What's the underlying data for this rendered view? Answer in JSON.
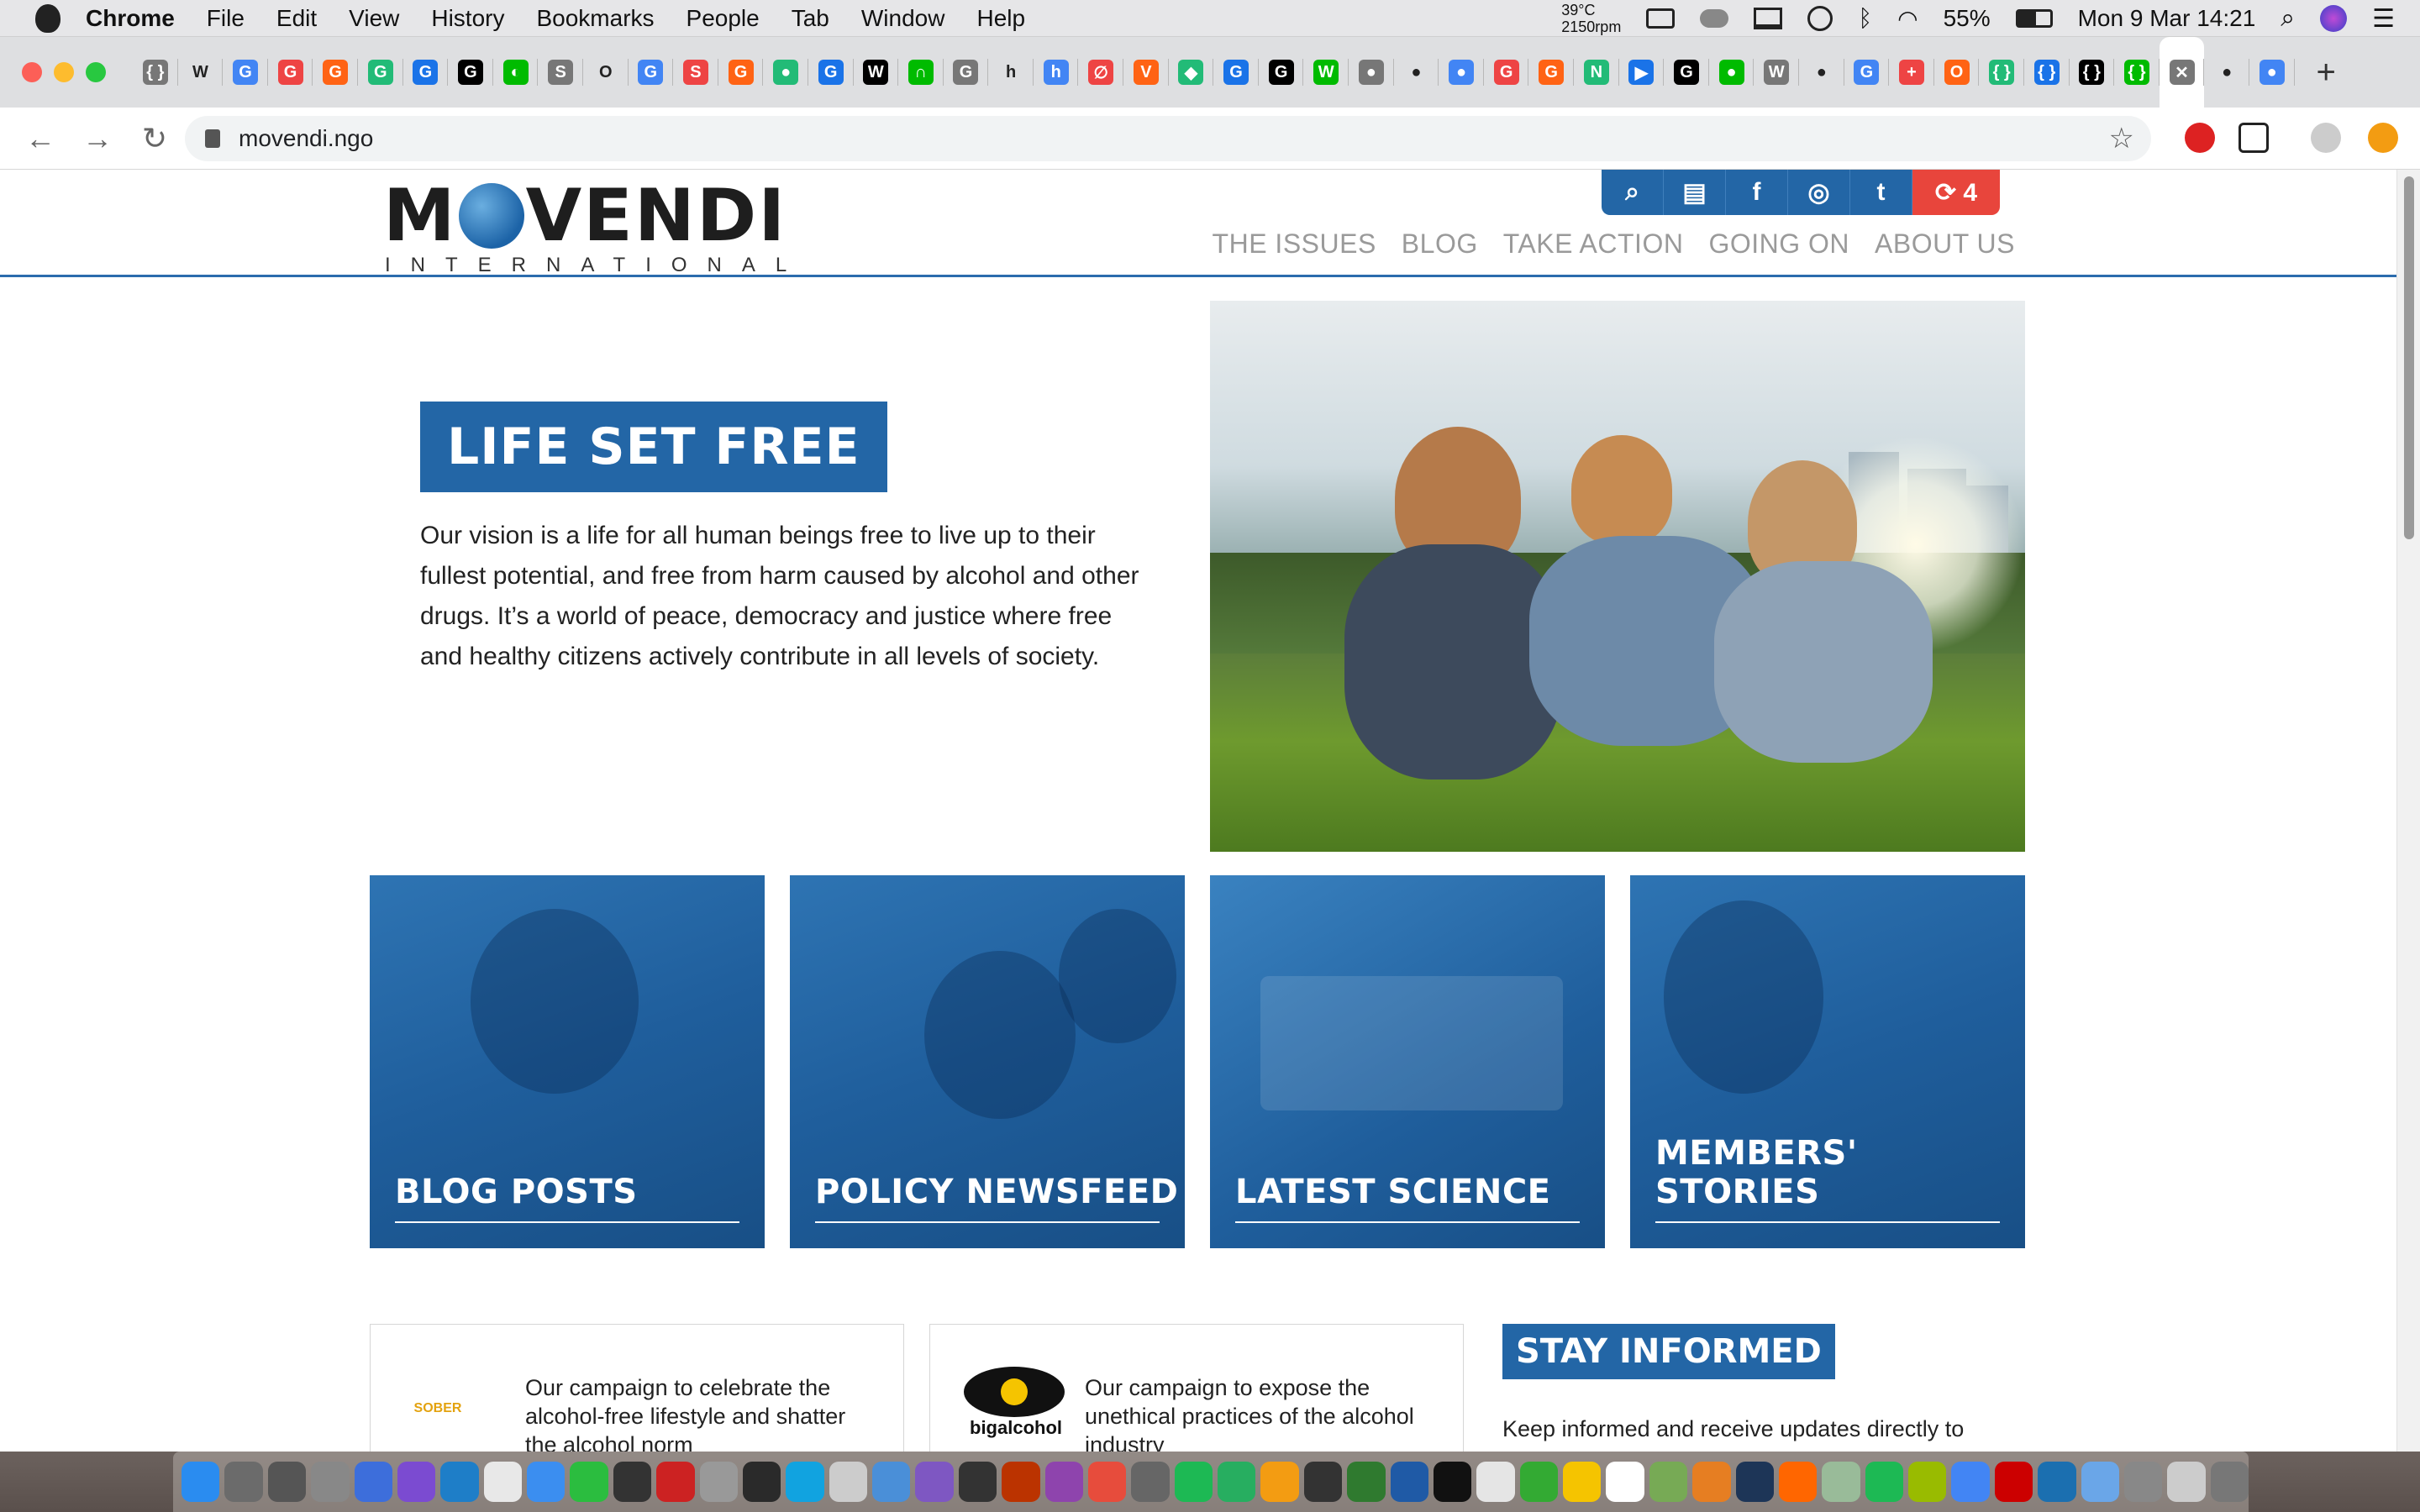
{
  "menubar": {
    "app": "Chrome",
    "items": [
      "File",
      "Edit",
      "View",
      "History",
      "Bookmarks",
      "People",
      "Tab",
      "Window",
      "Help"
    ],
    "temp": "39°C",
    "fan": "2150rpm",
    "battery": "55%",
    "clock": "Mon 9 Mar  14:21"
  },
  "tabs": {
    "favicons": [
      "{ }",
      "W",
      "G",
      "G",
      "G",
      "G",
      "G",
      "G",
      "◐",
      "S",
      "O",
      "G",
      "S",
      "G",
      "●",
      "G",
      "W",
      "∩",
      "G",
      "h",
      "h",
      "∅",
      "V",
      "◆",
      "G",
      "G",
      "W",
      "●",
      "●",
      "●",
      "G",
      "G",
      "N",
      "▶",
      "G",
      "●",
      "W",
      "●",
      "G",
      "+",
      "O",
      "{ }",
      "{ }",
      "{ }",
      "{ }",
      "✕",
      "●",
      "●"
    ],
    "active_close": "✕",
    "new_tab": "+"
  },
  "toolbar": {
    "back": "←",
    "forward": "→",
    "reload": "↻",
    "url": "movendi.ngo",
    "star": "☆"
  },
  "site": {
    "logo_word_left": "M",
    "logo_word_right": "VENDI",
    "logo_sub": "INTERNATIONAL",
    "social": {
      "search": "⌕",
      "news": "▤",
      "facebook": "f",
      "instagram": "◎",
      "twitter": "t",
      "refresh": "⟳ 4"
    },
    "nav": [
      "THE ISSUES",
      "BLOG",
      "TAKE ACTION",
      "GOING ON",
      "ABOUT US"
    ],
    "hero": {
      "title": "LIFE SET FREE",
      "text": "Our vision is a life for all human beings free to live up to their fullest potential, and free from harm caused by alcohol and other drugs. It’s a world of peace, democracy and justice where free and healthy citizens actively contribute in all levels of society."
    },
    "cards": [
      "BLOG POSTS",
      "POLICY NEWSFEED",
      "LATEST SCIENCE",
      "MEMBERS' STORIES"
    ],
    "promos": [
      {
        "logo": "SOBER",
        "text": "Our campaign to celebrate the alcohol-free lifestyle and shatter the alcohol norm"
      },
      {
        "logo": "bigalcohol",
        "text": "Our campaign to expose the unethical practices of the alcohol industry"
      }
    ],
    "stay_informed": {
      "title": "STAY INFORMED",
      "text": "Keep informed and receive updates directly to"
    }
  },
  "colors": {
    "brand_blue": "#2366a6",
    "refresh_red": "#e8453c",
    "nav_gray": "#9a9a9a"
  }
}
